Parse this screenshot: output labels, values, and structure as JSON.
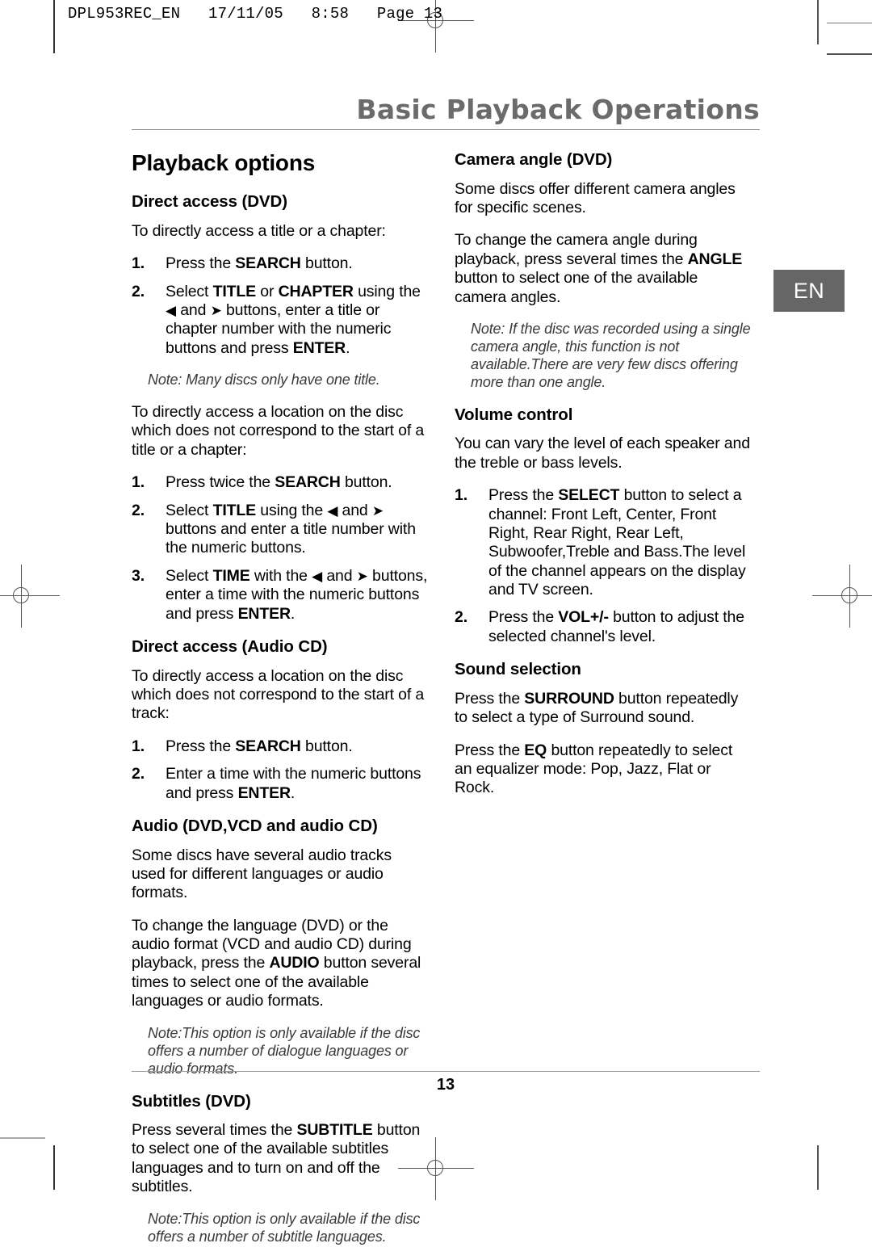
{
  "slug": "DPL953REC_EN   17/11/05   8:58   Page 13",
  "header": {
    "title": "Basic Playback Operations"
  },
  "language_tab": {
    "label": "EN",
    "background": "#666666",
    "text_color": "#ffffff"
  },
  "footer": {
    "page_number": "13"
  },
  "left_column": {
    "section_heading": "Playback options",
    "blocks": {
      "direct_access_dvd_heading": "Direct access (DVD)",
      "direct_access_dvd_intro": "To directly access a title or a chapter:",
      "step1_num": "1.",
      "step1_a": "Press the ",
      "step1_b": "SEARCH",
      "step1_c": " button.",
      "step2_num": "2.",
      "step2_a": "Select ",
      "step2_b": "TITLE",
      "step2_c": " or ",
      "step2_d": "CHAPTER",
      "step2_e": " using the ",
      "step2_f": " and ",
      "step2_g": " buttons, enter a title or chapter number with the numeric buttons and press ",
      "step2_h": "ENTER",
      "step2_i": ".",
      "note1": "Note: Many discs only have one title.",
      "intro2": "To directly access a location on the disc which does not correspond to the start of a title or a chapter:",
      "b_step1_num": "1.",
      "b_step1_a": "Press twice the ",
      "b_step1_b": "SEARCH",
      "b_step1_c": " button.",
      "b_step2_num": "2.",
      "b_step2_a": "Select ",
      "b_step2_b": "TITLE",
      "b_step2_c": " using the ",
      "b_step2_d": " and ",
      "b_step2_e": " buttons and enter a title number with the numeric buttons.",
      "b_step3_num": "3.",
      "b_step3_a": "Select ",
      "b_step3_b": "TIME",
      "b_step3_c": " with the ",
      "b_step3_d": " and ",
      "b_step3_e": " buttons, enter a time with the numeric buttons and press ",
      "b_step3_f": "ENTER",
      "b_step3_g": ".",
      "direct_access_cd_heading": "Direct access (Audio CD)",
      "direct_access_cd_intro": "To directly access a location on the disc which does not correspond to the start of a track:",
      "c_step1_num": "1.",
      "c_step1_a": "Press the ",
      "c_step1_b": "SEARCH",
      "c_step1_c": " button.",
      "c_step2_num": "2.",
      "c_step2_a": "Enter a time with the numeric buttons and press ",
      "c_step2_b": "ENTER",
      "c_step2_c": ".",
      "audio_heading": "Audio (DVD,VCD and audio CD)",
      "audio_p1": "Some discs have several audio tracks used for different languages or audio formats.",
      "audio_p2_a": "To change the language (DVD) or the audio format (VCD and audio CD) during playback, press the ",
      "audio_p2_b": "AUDIO",
      "audio_p2_c": " button several times to select one of the available languages or audio formats.",
      "audio_note": "Note:This option is only available if the disc offers a number of dialogue languages or audio formats.",
      "subtitles_heading": "Subtitles (DVD)",
      "subtitles_p_a": "Press several times the ",
      "subtitles_p_b": "SUBTITLE",
      "subtitles_p_c": " button to select one of the available subtitles languages and to turn on and off the subtitles.",
      "subtitles_note": "Note:This option is only available if the disc offers a number of subtitle languages."
    }
  },
  "right_column": {
    "blocks": {
      "camera_heading": "Camera angle (DVD)",
      "camera_p1": "Some discs offer different camera angles for specific scenes.",
      "camera_p2_a": "To change the camera angle during playback, press several times the ",
      "camera_p2_b": "ANGLE",
      "camera_p2_c": " button to select one of the available camera angles.",
      "camera_note": "Note: If the disc was recorded using a single camera angle, this function is not available.There are very few discs offering more than one angle.",
      "volume_heading": "Volume control",
      "volume_p1": "You can vary the level of each speaker and the treble or bass levels.",
      "v_step1_num": "1.",
      "v_step1_a": "Press the ",
      "v_step1_b": "SELECT",
      "v_step1_c": " button to select a channel: Front Left, Center, Front Right, Rear Right, Rear Left, Subwoofer,Treble and Bass.The level of the channel appears on the display and TV screen.",
      "v_step2_num": "2.",
      "v_step2_a": "Press the ",
      "v_step2_b": "VOL+/-",
      "v_step2_c": " button to adjust the selected channel's level.",
      "sound_heading": "Sound selection",
      "sound_p1_a": "Press the ",
      "sound_p1_b": "SURROUND",
      "sound_p1_c": " button repeatedly to select a type of Surround sound.",
      "sound_p2_a": "Press the ",
      "sound_p2_b": "EQ",
      "sound_p2_c": " button repeatedly to select an equalizer mode: Pop, Jazz, Flat or Rock."
    }
  },
  "icons": {
    "arrow_left": "◀",
    "arrow_right": "➤"
  }
}
